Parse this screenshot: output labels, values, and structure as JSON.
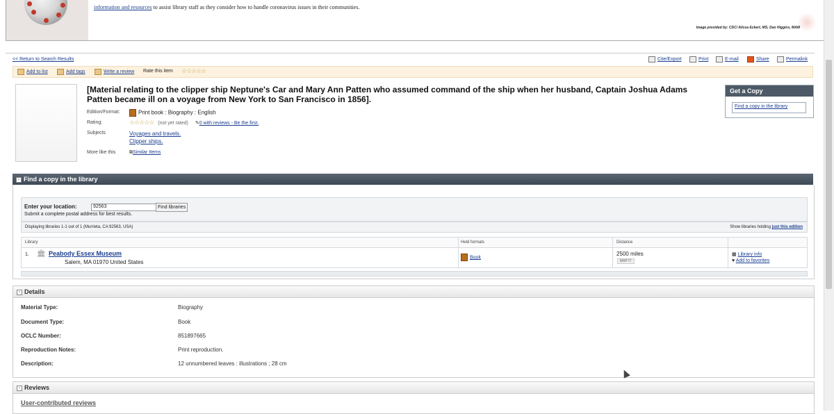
{
  "banner": {
    "link_text": "information and resources",
    "text": " to assist library staff as they consider how to handle coronavirus issues in their communities.",
    "credit": "Image provided by: CDC/ Alissa Eckert, MS; Dan Higgins, MAM"
  },
  "toplinks": {
    "return": "<< Return to Search Results",
    "cite": "Cite/Export",
    "print": "Print",
    "email": "E-mail",
    "share": "Share",
    "permalink": "Permalink"
  },
  "actions": {
    "add_list": "Add to list",
    "add_tags": "Add tags",
    "write_review": "Write a review",
    "rate": "Rate this item",
    "stars": "☆☆☆☆☆"
  },
  "record": {
    "title": "[Material relating to the clipper ship Neptune's Car and Mary Ann Patten who assumed command of the ship when her husband, Captain Joshua Adams Patten became ill on a voyage from New York to San Francisco in 1856].",
    "edition_label": "Edition/Format:",
    "edition_value": "Print book : Biography : English",
    "rating_label": "Rating:",
    "rating_stars": "☆☆☆☆☆",
    "rating_note": "(not yet rated)",
    "reviews_link": "0 with reviews - Be the first.",
    "subjects_label": "Subjects",
    "subjects": [
      "Voyages and travels.",
      "Clipper ships."
    ],
    "more_label": "More like this",
    "similar": "Similar Items"
  },
  "getcopy": {
    "header": "Get a Copy",
    "button": "Find a copy in the library"
  },
  "findcopy": {
    "header": "Find a copy in the library",
    "toggle": "-",
    "location_label": "Enter your location:",
    "location_value": "92563",
    "find_button": "Find libraries",
    "help": "Submit a complete postal address for best results.",
    "displaying": "Displaying libraries 1-1 out of 1 (Murrieta, CA 92563, USA)",
    "show_holding": "Show libraries holding ",
    "just_edition": "just this edition",
    "columns": {
      "library": "Library",
      "formats": "Held formats",
      "distance": "Distance"
    },
    "row": {
      "num": "1.",
      "name": "Peabody Essex Museum",
      "address": "Salem, MA 01970 United States",
      "format": "Book",
      "distance": "2500 miles",
      "map": "MAP IT",
      "info": "Library info",
      "favorites": "Add to favorites"
    }
  },
  "details": {
    "header": "Details",
    "toggle": "-",
    "rows": [
      {
        "label": "Material Type:",
        "value": "Biography"
      },
      {
        "label": "Document Type:",
        "value": "Book"
      },
      {
        "label": "OCLC Number:",
        "value": "851897665"
      },
      {
        "label": "Reproduction Notes:",
        "value": "Print reproduction."
      },
      {
        "label": "Description:",
        "value": "12 unnumbered leaves : illustrations ; 28 cm"
      }
    ]
  },
  "reviews": {
    "header": "Reviews",
    "toggle": "-",
    "link": "User-contributed reviews"
  }
}
